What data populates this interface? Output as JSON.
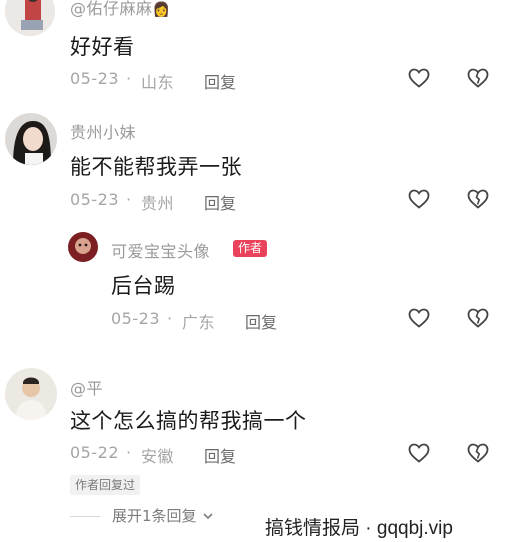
{
  "comments": [
    {
      "username": "@佑仔麻麻",
      "emoji": "👩",
      "text": "好好看",
      "date": "05-23",
      "location": "山东",
      "reply": "回复"
    },
    {
      "username": "贵州小妹",
      "text": "能不能帮我弄一张",
      "date": "05-23",
      "location": "贵州",
      "reply": "回复"
    },
    {
      "username": "可爱宝宝头像",
      "badge": "作者",
      "text": "后台踢",
      "date": "05-23",
      "location": "广东",
      "reply": "回复"
    },
    {
      "username": "@平",
      "text": "这个怎么搞的帮我搞一个",
      "date": "05-22",
      "location": "安徽",
      "reply": "回复",
      "author_replied": "作者回复过",
      "expand": "展开1条回复"
    }
  ],
  "separator": "·",
  "watermark": "搞钱情报局 ·  gqqbj.vip",
  "colors": {
    "badge": "#e9425a",
    "meta": "#a5a5a5",
    "name": "#9a9a9a"
  }
}
